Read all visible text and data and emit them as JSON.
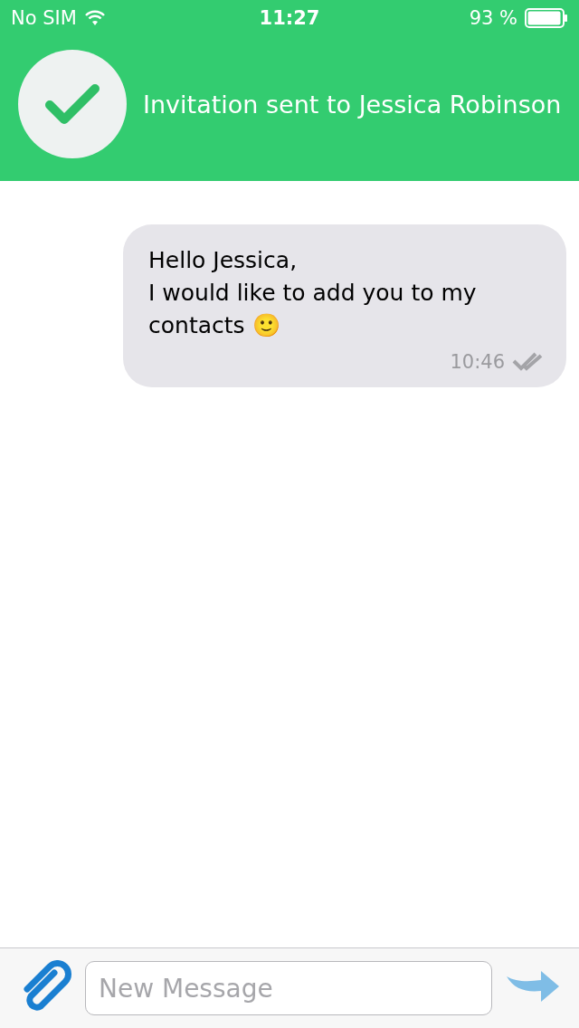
{
  "status_bar": {
    "carrier": "No SIM",
    "time": "11:27",
    "battery": "93 %"
  },
  "banner": {
    "text": "Invitation sent to Jessica Robinson"
  },
  "messages": [
    {
      "text": "Hello Jessica,\nI would like to add you to my contacts 🙂",
      "time": "10:46"
    }
  ],
  "composer": {
    "placeholder": "New Message"
  }
}
